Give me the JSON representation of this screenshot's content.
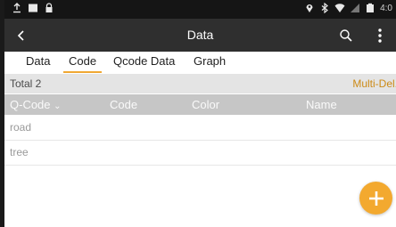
{
  "status_bar": {
    "time": "4:0",
    "icons_left": [
      "upload-icon",
      "image-icon",
      "lock-icon"
    ],
    "icons_right": [
      "location-icon",
      "bluetooth-icon",
      "wifi-icon",
      "signal-icon",
      "battery-icon"
    ]
  },
  "app_bar": {
    "title": "Data",
    "back_icon": "chevron-left-icon",
    "search_icon": "search-icon",
    "more_icon": "more-vertical-icon"
  },
  "tabs": [
    {
      "label": "Data",
      "active": false
    },
    {
      "label": "Code",
      "active": true
    },
    {
      "label": "Qcode Data",
      "active": false
    },
    {
      "label": "Graph",
      "active": false
    }
  ],
  "summary": {
    "total_label": "Total 2",
    "multi_delete_label": "Multi-Del."
  },
  "table": {
    "columns": [
      "Q-Code",
      "Code",
      "Color",
      "Name"
    ],
    "sort_indicator": "⌄",
    "rows": [
      {
        "qcode": "road"
      },
      {
        "qcode": "tree"
      }
    ]
  },
  "fab": {
    "icon": "plus-icon",
    "color": "#f3a92f"
  },
  "colors": {
    "accent": "#f0a833",
    "multi_delete": "#cc8a16",
    "app_bar": "#2f2f2f",
    "status_bar": "#151515",
    "header_bg": "#c6c6c6",
    "summary_bg": "#e4e4e4"
  }
}
